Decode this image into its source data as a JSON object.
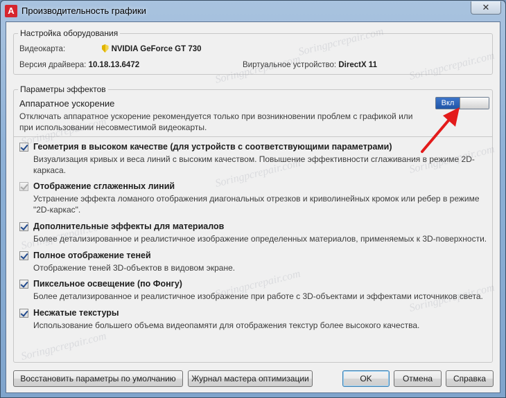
{
  "window": {
    "title": "Производительность графики",
    "app_icon_letter": "A",
    "close_glyph": "✕"
  },
  "hardware": {
    "legend": "Настройка оборудования",
    "gpu_label": "Видеокарта:",
    "gpu_value": "NVIDIA GeForce GT 730",
    "driver_label": "Версия драйвера:",
    "driver_value": "10.18.13.6472",
    "virtual_label": "Виртуальное устройство:",
    "virtual_value": "DirectX 11"
  },
  "effects": {
    "legend": "Параметры эффектов",
    "accel_title": "Аппаратное ускорение",
    "accel_desc": "Отключать аппаратное ускорение рекомендуется только при возникновении проблем с графикой или при использовании несовместимой видеокарты.",
    "toggle_label": "Вкл",
    "toggle_on": true,
    "options": [
      {
        "title": "Геометрия в высоком качестве (для устройств с соответствующими параметрами)",
        "desc": "Визуализация кривых и веса линий с высоким качеством. Повышение эффективности сглаживания в режиме 2D-каркаса.",
        "checked": true,
        "enabled": true
      },
      {
        "title": "Отображение сглаженных линий",
        "desc": "Устранение эффекта ломаного отображения диагональных отрезков и криволинейных кромок или ребер в режиме \"2D-каркас\".",
        "checked": true,
        "enabled": false
      },
      {
        "title": "Дополнительные эффекты для материалов",
        "desc": "Более детализированное и реалистичное изображение определенных материалов, применяемых к 3D-поверхности.",
        "checked": true,
        "enabled": true
      },
      {
        "title": "Полное отображение теней",
        "desc": "Отображение теней 3D-объектов в видовом экране.",
        "checked": true,
        "enabled": true
      },
      {
        "title": "Пиксельное освещение (по Фонгу)",
        "desc": "Более детализированное и реалистичное изображение при работе с 3D-объектами и эффектами источников света.",
        "checked": true,
        "enabled": true
      },
      {
        "title": "Несжатые текстуры",
        "desc": "Использование большего объема видеопамяти для отображения текстур более высокого качества.",
        "checked": true,
        "enabled": true
      }
    ]
  },
  "buttons": {
    "restore": "Восстановить параметры по умолчанию",
    "log": "Журнал мастера оптимизации",
    "ok": "OK",
    "cancel": "Отмена",
    "help": "Справка"
  },
  "watermark_text": "Soringpcrepair.com",
  "colors": {
    "toggle_on": "#2a62b8",
    "check": "#214a8d",
    "annotation_arrow": "#e31b1b"
  }
}
